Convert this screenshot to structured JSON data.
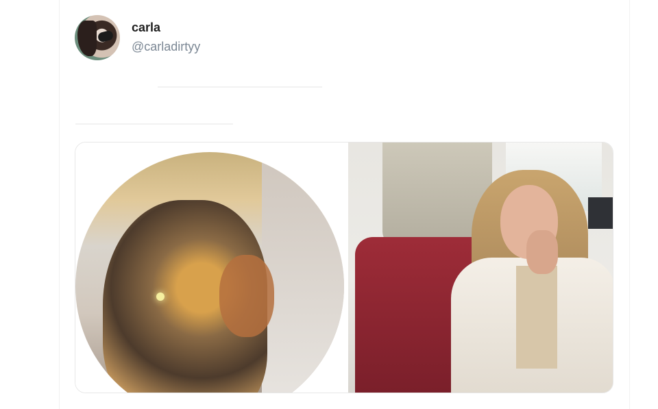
{
  "tweet": {
    "author": {
      "display_name": "carla",
      "handle": "@carladirtyy",
      "avatar_icon": "profile-avatar"
    },
    "media": {
      "left_image": "circular-cropped-photo",
      "right_image": "office-photo"
    }
  }
}
